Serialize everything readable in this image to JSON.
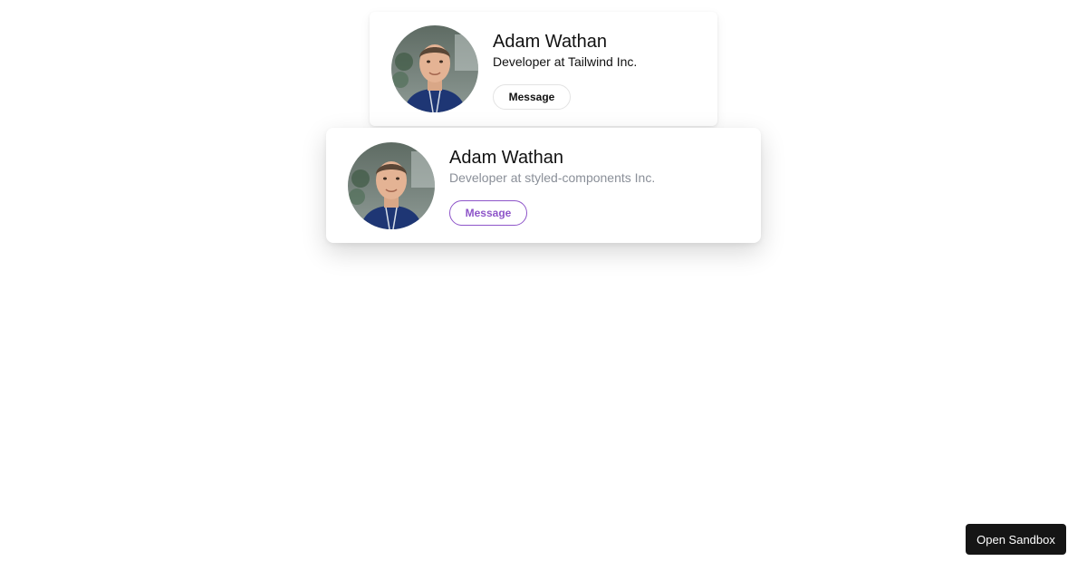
{
  "cards": [
    {
      "name": "Adam Wathan",
      "role": "Developer at Tailwind Inc.",
      "button_label": "Message",
      "avatar_alt": "Adam Wathan"
    },
    {
      "name": "Adam Wathan",
      "role": "Developer at styled-components Inc.",
      "button_label": "Message",
      "accent_color": "#8e55c9"
    }
  ],
  "footer": {
    "sandbox_label": "Open Sandbox"
  }
}
